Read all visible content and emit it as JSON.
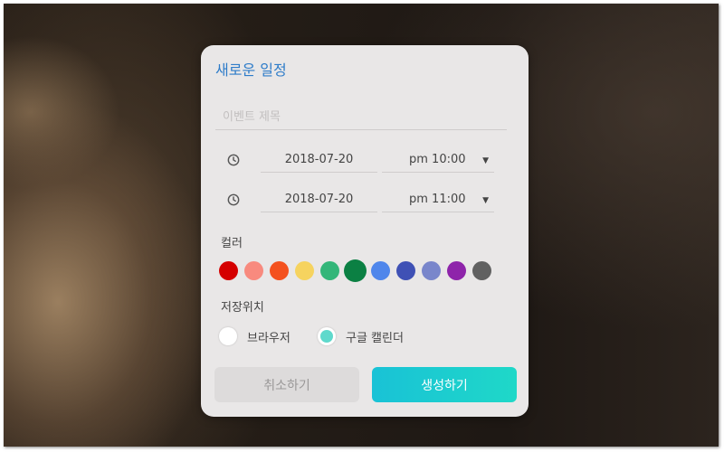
{
  "dialog": {
    "title": "새로운 일정",
    "event_title": {
      "value": "",
      "placeholder": "이벤트 제목"
    },
    "start": {
      "date": "2018-07-20",
      "time": "pm 10:00"
    },
    "end": {
      "date": "2018-07-20",
      "time": "pm 11:00"
    },
    "color_label": "컬러",
    "colors": [
      "#d50000",
      "#f88a7e",
      "#f4511e",
      "#f6d35f",
      "#33b679",
      "#0b8043",
      "#4f86eb",
      "#3f51b5",
      "#7986cb",
      "#8e24aa",
      "#616161"
    ],
    "selected_color": "#0b8043",
    "storage_label": "저장위치",
    "storage_options": [
      {
        "label": "브라우저",
        "checked": false
      },
      {
        "label": "구글 캘린더",
        "checked": true
      }
    ],
    "cancel_label": "취소하기",
    "create_label": "생성하기"
  },
  "icons": {
    "clock": "clock-icon",
    "dropdown": "caret-down-icon"
  }
}
